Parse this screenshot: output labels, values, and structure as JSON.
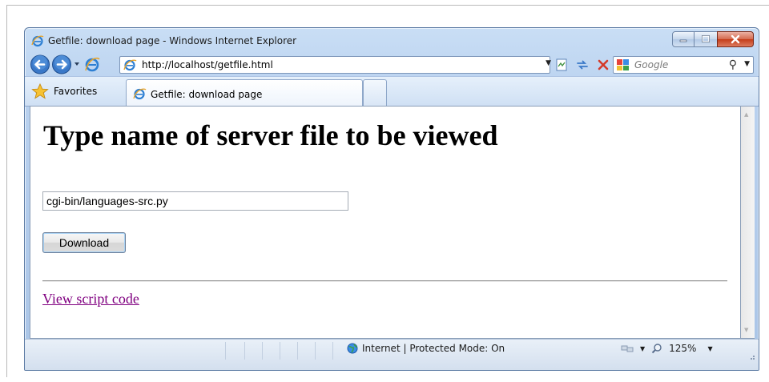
{
  "window": {
    "title": "Getfile: download page - Windows Internet Explorer",
    "colors": {
      "close": "#c43c18",
      "chrome": "#b9d1ef",
      "link_visited": "#800080"
    }
  },
  "nav": {
    "address": "http://localhost/getfile.html",
    "search_placeholder": "Google"
  },
  "tabs": {
    "favorites_label": "Favorites",
    "active_tab_label": "Getfile: download page"
  },
  "page": {
    "heading": "Type name of server file to be viewed",
    "filename_value": "cgi-bin/languages-src.py",
    "download_label": "Download",
    "link_text": "View script code"
  },
  "status": {
    "zone_text": "Internet | Protected Mode: On",
    "zoom": "125%"
  }
}
